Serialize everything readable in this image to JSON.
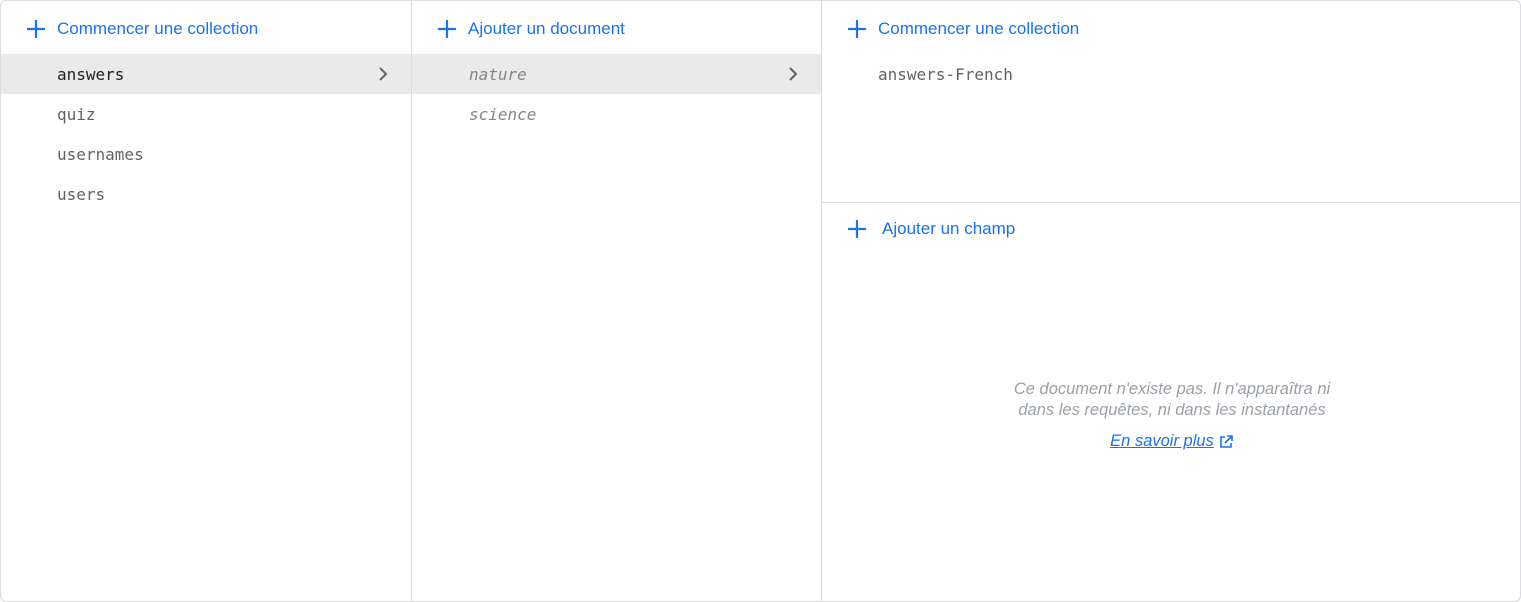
{
  "panel_collections": {
    "action_label": "Commencer une collection",
    "items": [
      {
        "label": "answers",
        "selected": true
      },
      {
        "label": "quiz"
      },
      {
        "label": "usernames"
      },
      {
        "label": "users"
      }
    ]
  },
  "panel_documents": {
    "action_label": "Ajouter un document",
    "items": [
      {
        "label": "nature",
        "selected": true
      },
      {
        "label": "science"
      }
    ]
  },
  "panel_document_detail": {
    "collection_action_label": "Commencer une collection",
    "subcollections": [
      {
        "label": "answers-French"
      }
    ],
    "field_action_label": "Ajouter un champ",
    "empty_message": "Ce document n'existe pas. Il n'apparaîtra ni dans les requêtes, ni dans les instantanés",
    "learn_more_label": "En savoir plus"
  },
  "colors": {
    "accent": "#1a73e8",
    "selected_row": "#eaeaea",
    "border": "#dadce0",
    "muted_text": "#9aa0a6"
  },
  "icons": [
    "plus-icon",
    "chevron-right-icon",
    "open-in-new-icon"
  ]
}
